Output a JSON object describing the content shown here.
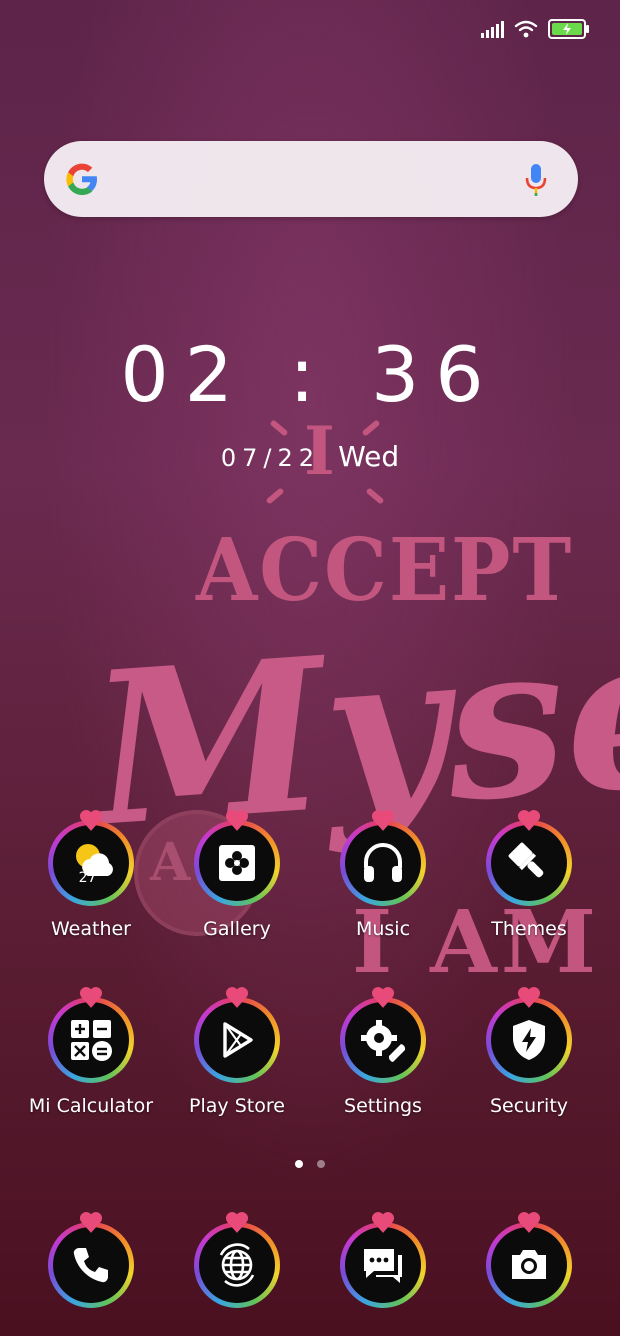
{
  "wallpaper": {
    "line1": "I",
    "line2": "ACCEPT",
    "line3": "Myself",
    "line4": "A",
    "line5": "I AM"
  },
  "status_bar": {
    "battery_color": "#6ad94a"
  },
  "search": {
    "icons": [
      "google-logo-icon",
      "microphone-icon"
    ]
  },
  "clock": {
    "time": "02 : 36",
    "date": "07/22",
    "weekday": "Wed"
  },
  "apps": [
    {
      "label": "Weather",
      "icon": "weather-sun-cloud-icon",
      "temp": "27°"
    },
    {
      "label": "Gallery",
      "icon": "gallery-flower-icon"
    },
    {
      "label": "Music",
      "icon": "headphones-icon"
    },
    {
      "label": "Themes",
      "icon": "paintbrush-icon"
    },
    {
      "label": "Mi Calculator",
      "icon": "calculator-icon"
    },
    {
      "label": "Play Store",
      "icon": "play-store-icon"
    },
    {
      "label": "Settings",
      "icon": "gear-wrench-icon"
    },
    {
      "label": "Security",
      "icon": "shield-bolt-icon"
    }
  ],
  "page_indicator": {
    "pages": 2,
    "current": 1
  },
  "dock": [
    {
      "icon": "phone-icon"
    },
    {
      "icon": "browser-globe-icon"
    },
    {
      "icon": "messages-icon"
    },
    {
      "icon": "camera-icon"
    }
  ]
}
